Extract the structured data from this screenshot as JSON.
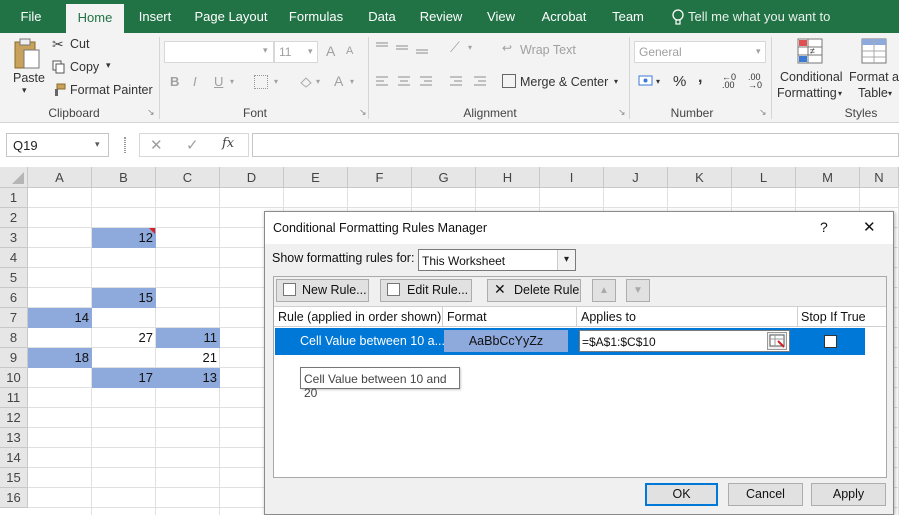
{
  "tabs": [
    "File",
    "Home",
    "Insert",
    "Page Layout",
    "Formulas",
    "Data",
    "Review",
    "View",
    "Acrobat",
    "Team"
  ],
  "tell_me": "Tell me what you want to do...",
  "clipboard": {
    "paste": "Paste",
    "cut": "Cut",
    "copy": "Copy",
    "format_painter": "Format Painter",
    "label": "Clipboard"
  },
  "font": {
    "size": "11",
    "bold": "B",
    "italic": "I",
    "underline": "U",
    "grow": "A",
    "shrink": "A",
    "color": "A",
    "label": "Font"
  },
  "alignment": {
    "wrap": "Wrap Text",
    "merge": "Merge & Center",
    "label": "Alignment"
  },
  "number": {
    "format": "General",
    "percent": "%",
    "comma": ",",
    "label": "Number"
  },
  "styles": {
    "cond_line1": "Conditional",
    "cond_line2": "Formatting",
    "fmt_line1": "Format as",
    "fmt_line2": "Table",
    "label": "Styles"
  },
  "formula_bar": {
    "name_box": "Q19",
    "fx": "fx",
    "cancel": "✕",
    "enter": "✓"
  },
  "columns": [
    "A",
    "B",
    "C",
    "D",
    "E",
    "F",
    "G",
    "H",
    "I",
    "J",
    "K",
    "L",
    "M",
    "N"
  ],
  "rows": [
    "1",
    "2",
    "3",
    "4",
    "5",
    "6",
    "7",
    "8",
    "9",
    "10",
    "11",
    "12",
    "13",
    "14",
    "15",
    "16"
  ],
  "cells": {
    "B3": "12",
    "B6": "15",
    "A7": "14",
    "B8": "27",
    "C8": "11",
    "A9": "18",
    "C9": "21",
    "B10": "17",
    "C10": "13"
  },
  "colors": {
    "excel_green": "#217346",
    "highlight": "#8ea9db",
    "selection": "#0078d7"
  },
  "dialog": {
    "title": "Conditional Formatting Rules Manager",
    "help": "?",
    "close": "✕",
    "show_label": "Show formatting rules for:",
    "show_value": "This Worksheet",
    "new_rule": "New Rule...",
    "edit_rule": "Edit Rule...",
    "delete_rule": "Delete Rule",
    "headers": {
      "rule": "Rule (applied in order shown)",
      "format": "Format",
      "applies": "Applies to",
      "stop": "Stop If True"
    },
    "rule": {
      "text": "Cell Value between 10 a...",
      "preview": "AaBbCcYyZz",
      "applies": "=$A$1:$C$10"
    },
    "tooltip": "Cell Value between 10 and 20",
    "ok": "OK",
    "cancel": "Cancel",
    "apply": "Apply"
  }
}
